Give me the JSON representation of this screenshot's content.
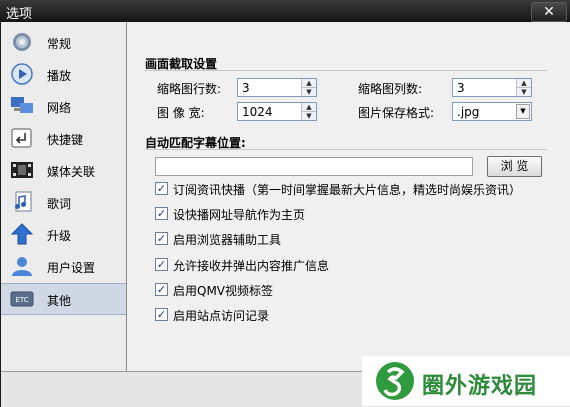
{
  "window": {
    "title": "选项",
    "close": "✕"
  },
  "sidebar": {
    "items": [
      {
        "label": "常规",
        "icon": "gear-icon"
      },
      {
        "label": "播放",
        "icon": "play-icon"
      },
      {
        "label": "网络",
        "icon": "network-icon"
      },
      {
        "label": "快捷键",
        "icon": "shortcut-key-icon"
      },
      {
        "label": "媒体关联",
        "icon": "media-association-icon"
      },
      {
        "label": "歌词",
        "icon": "lyrics-icon"
      },
      {
        "label": "升级",
        "icon": "upgrade-arrow-icon"
      },
      {
        "label": "用户设置",
        "icon": "user-icon"
      },
      {
        "label": "其他",
        "icon": "etc-icon",
        "icon_text": "ETC",
        "selected": true
      }
    ]
  },
  "screenshot": {
    "title": "画面截取设置",
    "thumb_rows_label": "缩略图行数:",
    "thumb_rows_value": "3",
    "thumb_cols_label": "缩略图列数:",
    "thumb_cols_value": "3",
    "width_label": "图 像 宽:",
    "width_value": "1024",
    "format_label": "图片保存格式:",
    "format_value": ".jpg"
  },
  "subtitle": {
    "title": "自动匹配字幕位置:",
    "path_value": "",
    "browse_label": "浏 览"
  },
  "options": [
    {
      "label": "订阅资讯快播（第一时间掌握最新大片信息，精选时尚娱乐资讯）",
      "checked": true
    },
    {
      "label": "设快播网址导航作为主页",
      "checked": true
    },
    {
      "label": "启用浏览器辅助工具",
      "checked": true
    },
    {
      "label": "允许接收并弹出内容推广信息",
      "checked": true
    },
    {
      "label": "启用QMV视频标签",
      "checked": true
    },
    {
      "label": "启用站点访问记录",
      "checked": true
    }
  ],
  "watermark": {
    "text": "圈外游戏园"
  },
  "colors": {
    "titlebar": "#1e1e1e",
    "selected": "#cfd8e4",
    "accent": "#2f9a3e"
  }
}
